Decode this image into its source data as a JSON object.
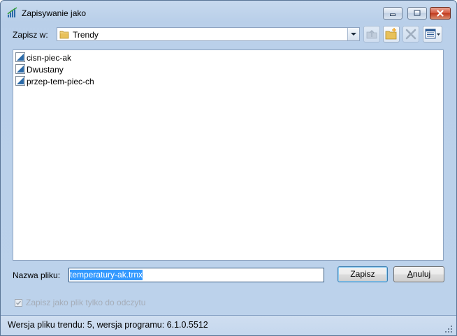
{
  "window": {
    "title": "Zapisywanie jako"
  },
  "caption_buttons": {
    "minimize": "minimize",
    "maximize": "maximize",
    "close": "close"
  },
  "location": {
    "label": "Zapisz w:",
    "current_folder": "Trendy"
  },
  "toolbar": {
    "up_folder": "up-folder-icon",
    "new_folder": "new-folder-icon",
    "delete": "delete-icon",
    "view_menu": "view-menu-icon"
  },
  "files": [
    {
      "name": "cisn-piec-ak"
    },
    {
      "name": "Dwustany"
    },
    {
      "name": "przep-tem-piec-ch"
    }
  ],
  "filename": {
    "label": "Nazwa pliku:",
    "value": "temperatury-ak.trnx"
  },
  "buttons": {
    "save": "Zapisz",
    "cancel_prefix": "",
    "cancel_underlined": "A",
    "cancel_rest": "nuluj"
  },
  "readonly_checkbox": {
    "label": "Zapisz jako plik tylko do odczytu",
    "checked": true,
    "enabled": false
  },
  "status": {
    "text": "Wersja pliku trendu: 5, wersja programu: 6.1.0.5512"
  },
  "colors": {
    "accent": "#3399ff",
    "frame": "#bcd2eb",
    "disabled_text": "#a5adb8"
  }
}
